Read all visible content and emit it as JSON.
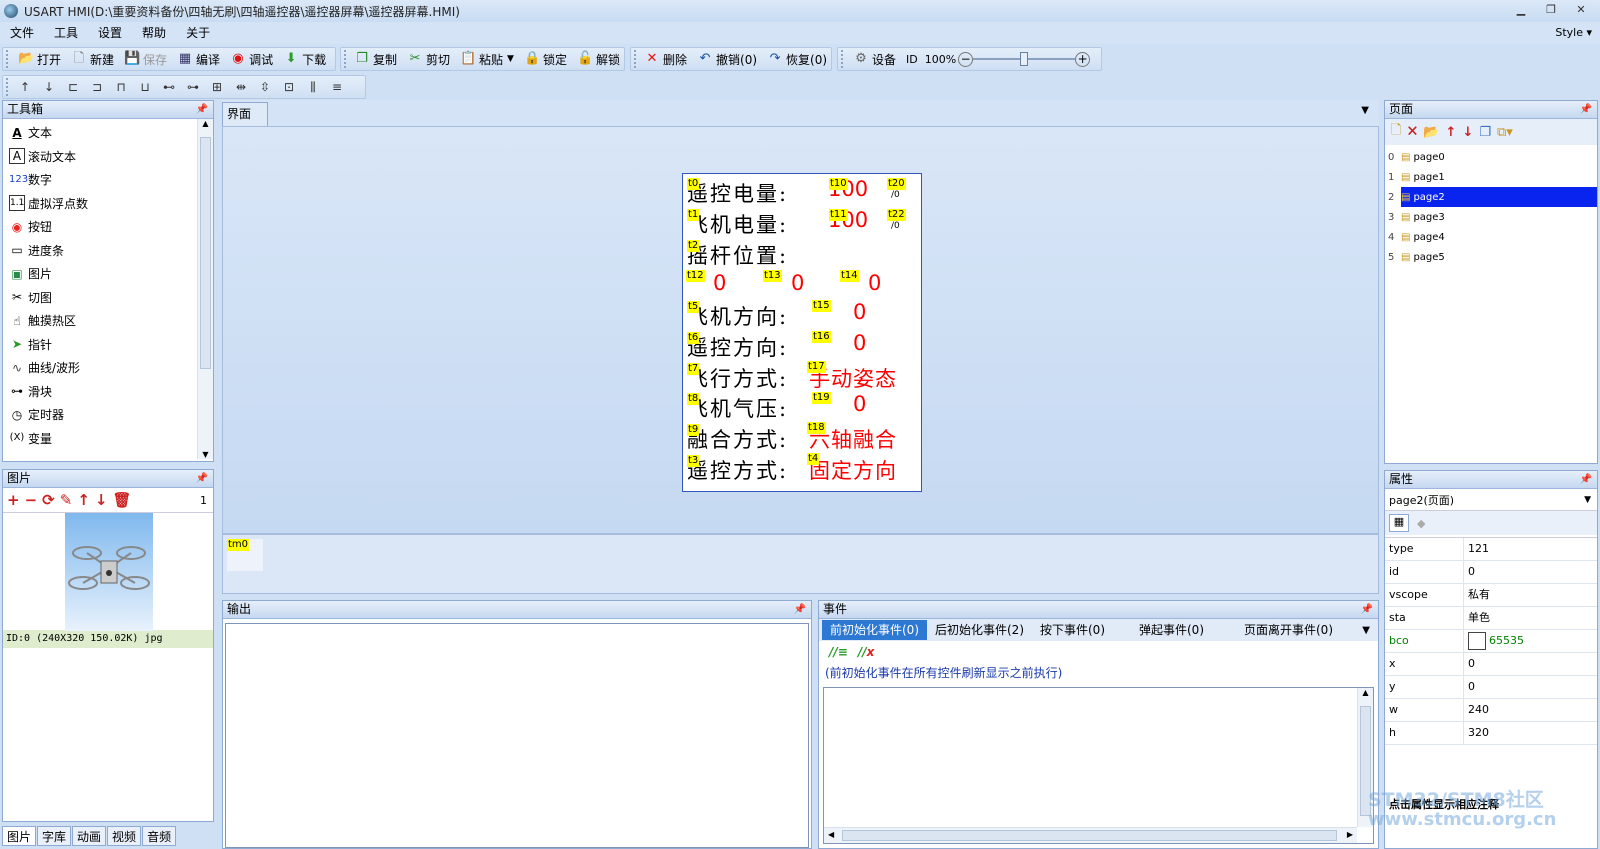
{
  "window": {
    "title": "USART HMI(D:\\重要资料备份\\四轴无刷\\四轴遥控器\\遥控器屏幕\\遥控器屏幕.HMI)"
  },
  "menu": [
    "文件",
    "工具",
    "设置",
    "帮助",
    "关于"
  ],
  "style_menu": "Style ▾",
  "toolbar": {
    "open": "打开",
    "new": "新建",
    "save": "保存",
    "compile": "编译",
    "debug": "调试",
    "download": "下载",
    "copy": "复制",
    "cut": "剪切",
    "paste": "粘贴",
    "lock": "锁定",
    "unlock": "解锁",
    "delete": "删除",
    "undo": "撤销(0)",
    "redo": "恢复(0)",
    "device": "设备",
    "id": "ID",
    "zoom": "100%"
  },
  "zoom_level": 0.5,
  "toolbox": {
    "title": "工具箱",
    "items": [
      "文本",
      "滚动文本",
      "数字",
      "虚拟浮点数",
      "按钮",
      "进度条",
      "图片",
      "切图",
      "触摸热区",
      "指针",
      "曲线/波形",
      "滑块",
      "定时器",
      "变量"
    ]
  },
  "pictures": {
    "title": "图片",
    "count": "1",
    "info": "ID:0  (240X320 150.02K) jpg"
  },
  "bottom_tabs": [
    "图片",
    "字库",
    "动画",
    "视频",
    "音频"
  ],
  "design": {
    "tab": "界面",
    "timer_tag": "tm0",
    "rows": [
      {
        "tag": "t0",
        "label": "遥控电量:"
      },
      {
        "tag": "t1",
        "label": "飞机电量:"
      },
      {
        "tag": "t2",
        "label": "摇杆位置:"
      },
      {
        "tag": "t5",
        "label": "飞机方向:"
      },
      {
        "tag": "t6",
        "label": "遥控方向:"
      },
      {
        "tag": "t7",
        "label": "飞行方式:"
      },
      {
        "tag": "t8",
        "label": "飞机气压:"
      },
      {
        "tag": "t9",
        "label": "融合方式:"
      },
      {
        "tag": "t3",
        "label": "遥控方式:"
      }
    ],
    "values": {
      "t10": "100",
      "t20": "/0",
      "t11": "100",
      "t22": "/0",
      "t12": "0",
      "t13": "0",
      "t14": "0",
      "t15": "0",
      "t16": "0",
      "t17": "手动姿态",
      "t19": "0",
      "t18": "六轴融合",
      "t4": "固定方向"
    }
  },
  "output": {
    "title": "输出"
  },
  "events": {
    "title": "事件",
    "tabs": [
      "前初始化事件(0)",
      "后初始化事件(2)",
      "按下事件(0)",
      "弹起事件(0)",
      "页面离开事件(0)"
    ],
    "hint": "(前初始化事件在所有控件刷新显示之前执行)"
  },
  "pages": {
    "title": "页面",
    "items": [
      {
        "index": "0",
        "name": "page0"
      },
      {
        "index": "1",
        "name": "page1"
      },
      {
        "index": "2",
        "name": "page2"
      },
      {
        "index": "3",
        "name": "page3"
      },
      {
        "index": "4",
        "name": "page4"
      },
      {
        "index": "5",
        "name": "page5"
      }
    ]
  },
  "properties": {
    "title": "属性",
    "selected": "page2(页面)",
    "rows": [
      {
        "k": "type",
        "v": "121"
      },
      {
        "k": "id",
        "v": "0"
      },
      {
        "k": "vscope",
        "v": "私有"
      },
      {
        "k": "sta",
        "v": "单色"
      },
      {
        "k": "bco",
        "v": "65535"
      },
      {
        "k": "x",
        "v": "0"
      },
      {
        "k": "y",
        "v": "0"
      },
      {
        "k": "w",
        "v": "240"
      },
      {
        "k": "h",
        "v": "320"
      }
    ],
    "footer": "点击属性显示相应注释"
  },
  "watermark": {
    "line1": "STM32/STM8社区",
    "line2": "www.stmcu.org.cn"
  },
  "colors": {
    "selection": "#0a24f0",
    "tag": "#ffff00",
    "value": "#ff0000",
    "bco_green": "#008000"
  }
}
